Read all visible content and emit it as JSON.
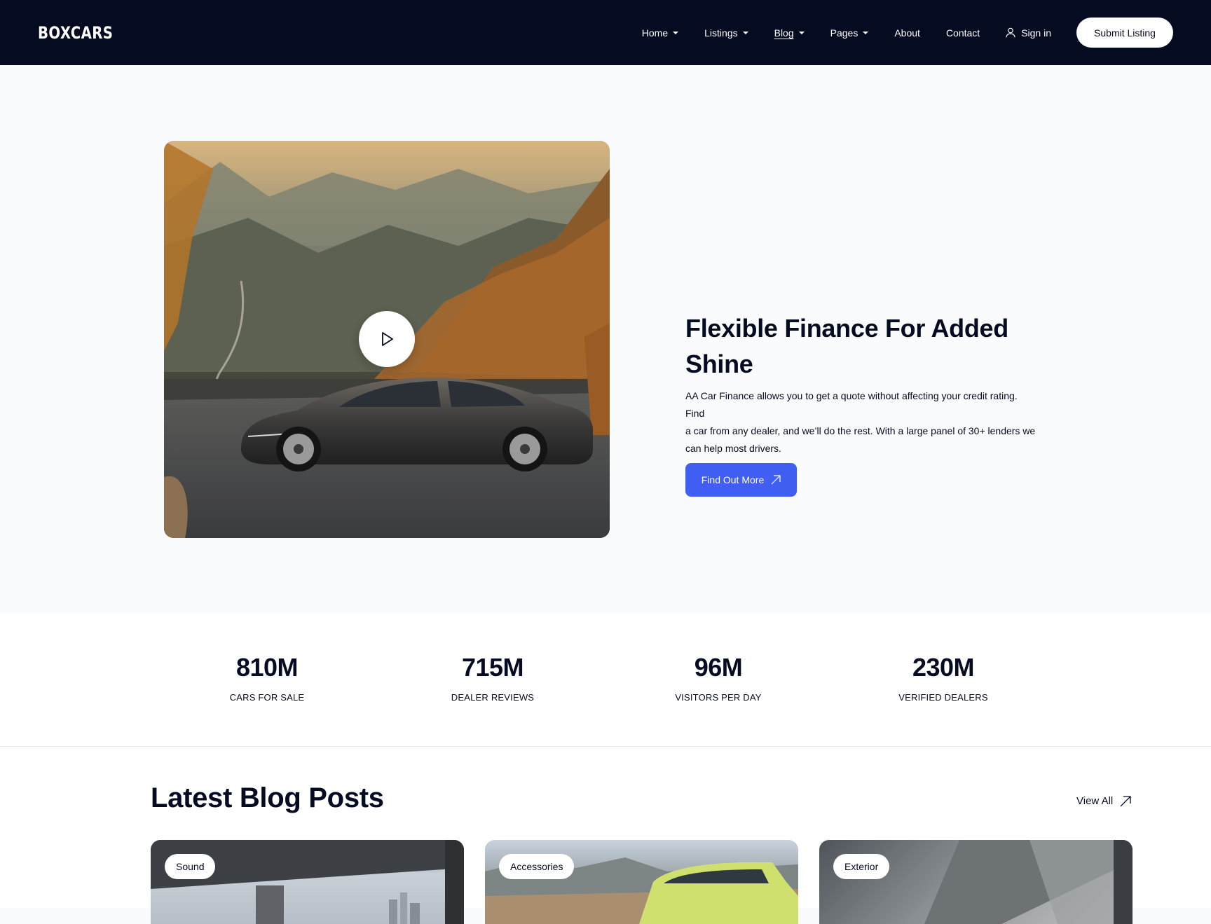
{
  "header": {
    "logo": "BOXCARS",
    "nav": [
      {
        "label": "Home",
        "dropdown": true
      },
      {
        "label": "Listings",
        "dropdown": true
      },
      {
        "label": "Blog",
        "dropdown": true
      },
      {
        "label": "Pages",
        "dropdown": true
      },
      {
        "label": "About",
        "dropdown": false
      },
      {
        "label": "Contact",
        "dropdown": false
      }
    ],
    "signin": "Sign in",
    "submit": "Submit Listing"
  },
  "hero": {
    "title_line1": "Flexible Finance For Added",
    "title_line2": "Shine",
    "desc_lines": [
      "AA Car Finance allows you to get a quote without affecting your credit rating.",
      "Find",
      "a car from any dealer, and we’ll do the rest. With a large panel of 30+ lenders we",
      "can help most drivers."
    ],
    "cta": "Find Out More"
  },
  "stats": [
    {
      "value": "810M",
      "label": "CARS FOR SALE"
    },
    {
      "value": "715M",
      "label": "DEALER REVIEWS"
    },
    {
      "value": "96M",
      "label": "VISITORS PER DAY"
    },
    {
      "value": "230M",
      "label": "VERIFIED DEALERS"
    }
  ],
  "blog": {
    "title": "Latest Blog Posts",
    "view_all": "View All",
    "cards": [
      {
        "category": "Sound"
      },
      {
        "category": "Accessories"
      },
      {
        "category": "Exterior"
      }
    ]
  },
  "colors": {
    "header_bg": "#050b20",
    "accent": "#405ff2",
    "page_bg": "#f9fbfc"
  }
}
